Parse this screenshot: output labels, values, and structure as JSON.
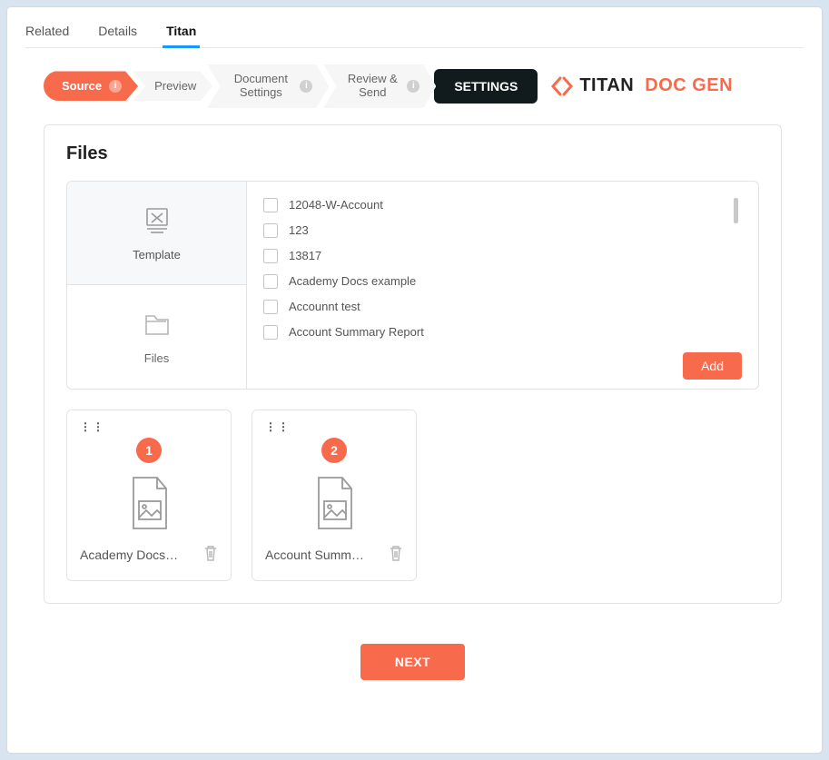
{
  "top_tabs": [
    {
      "label": "Related",
      "active": false
    },
    {
      "label": "Details",
      "active": false
    },
    {
      "label": "Titan",
      "active": true
    }
  ],
  "wizard": {
    "steps": [
      {
        "label": "Source",
        "active": true,
        "info": true
      },
      {
        "label": "Preview",
        "active": false,
        "info": false
      },
      {
        "label": "Document Settings",
        "active": false,
        "info": true
      },
      {
        "label": "Review & Send",
        "active": false,
        "info": true
      }
    ],
    "settings_label": "SETTINGS"
  },
  "logo": {
    "titan": "TITAN",
    "docgen": "DOC GEN"
  },
  "files_section": {
    "title": "Files",
    "selector_tabs": {
      "template": "Template",
      "files": "Files"
    },
    "file_list": [
      "12048-W-Account",
      "123",
      "13817",
      "Academy Docs example",
      "Accounnt test",
      "Account Summary Report"
    ],
    "add_label": "Add"
  },
  "selected_files": [
    {
      "order": "1",
      "name": "Academy Docs…"
    },
    {
      "order": "2",
      "name": "Account Summ…"
    }
  ],
  "next_label": "NEXT"
}
